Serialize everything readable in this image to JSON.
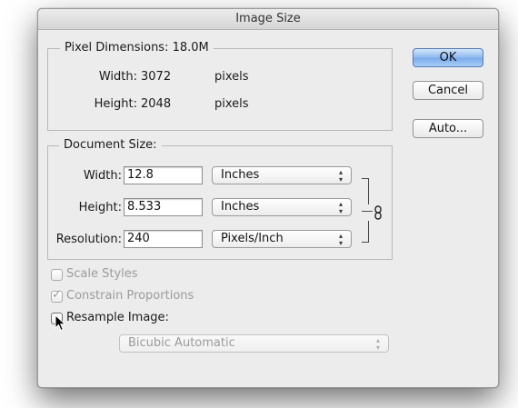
{
  "dialog": {
    "title": "Image Size"
  },
  "pixel_dimensions": {
    "legend": "Pixel Dimensions:",
    "size": "18.0M",
    "width_label": "Width:",
    "width_value": "3072",
    "width_unit": "pixels",
    "height_label": "Height:",
    "height_value": "2048",
    "height_unit": "pixels"
  },
  "document_size": {
    "legend": "Document Size:",
    "width_label": "Width:",
    "width_value": "12.8",
    "width_unit": "Inches",
    "height_label": "Height:",
    "height_value": "8.533",
    "height_unit": "Inches",
    "resolution_label": "Resolution:",
    "resolution_value": "240",
    "resolution_unit": "Pixels/Inch",
    "popup_arrow_glyph": "▴▾",
    "link_icon": "chain-link-icon"
  },
  "options": {
    "scale_styles": {
      "label": "Scale Styles",
      "checked": false,
      "enabled": false
    },
    "constrain_proportions": {
      "label": "Constrain Proportions",
      "checked": true,
      "enabled": false,
      "check_glyph": "✓"
    },
    "resample_image": {
      "label": "Resample Image:",
      "checked": false,
      "enabled": true
    },
    "resample_method": "Bicubic Automatic"
  },
  "buttons": {
    "ok": "OK",
    "cancel": "Cancel",
    "auto": "Auto..."
  },
  "colors": {
    "default_button": "#8db9ef",
    "dialog_background": "#ececec",
    "disabled_text": "#9c9c9c"
  }
}
